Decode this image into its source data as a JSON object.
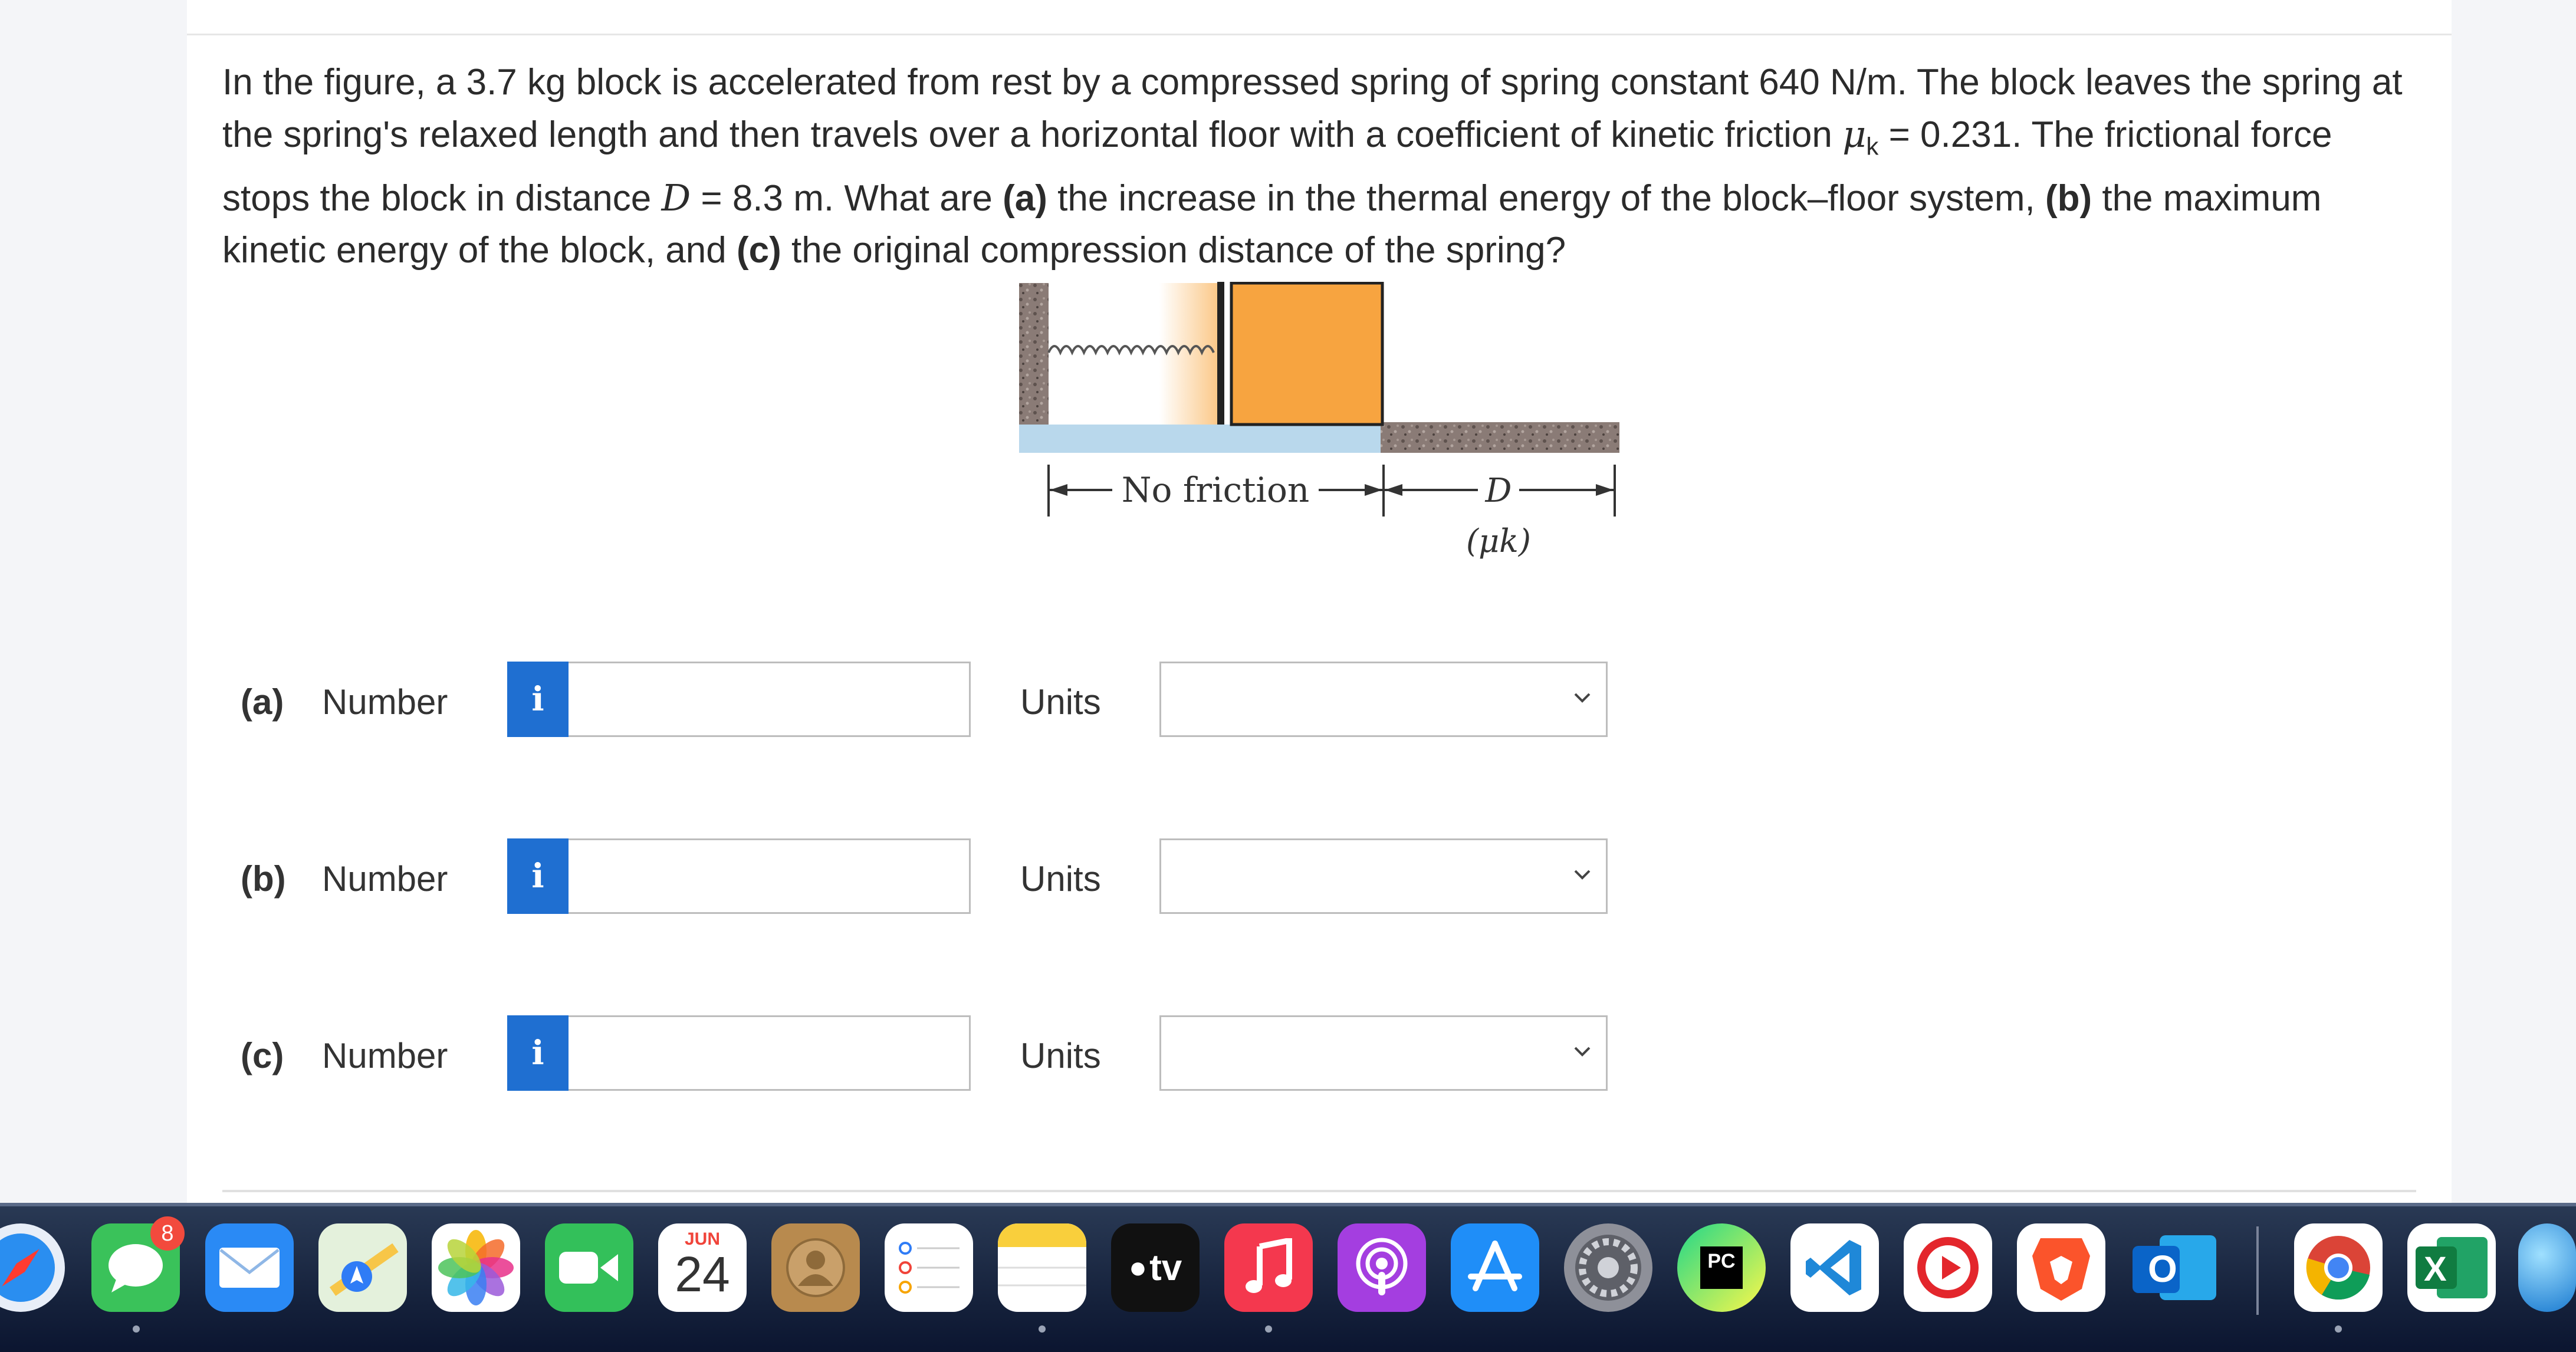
{
  "question": {
    "part1": "In the figure, a 3.7 kg block is accelerated from rest by a compressed spring of spring constant 640 N/m. The block leaves the spring at the spring's relaxed length and then travels over a horizontal floor with a coefficient of kinetic friction ",
    "mu_symbol": "μ",
    "mu_sub": "k",
    "part2": " = 0.231. The frictional force stops the block in distance ",
    "d_symbol": "D",
    "part3": " = 8.3 m. What are ",
    "a_tag": "(a)",
    "part4": " the increase in the thermal energy of the block–floor system, ",
    "b_tag": "(b)",
    "part5": " the maximum kinetic energy of the block, and ",
    "c_tag": "(c)",
    "part6": " the original compression distance of the spring?"
  },
  "figure": {
    "no_friction_label": "No friction",
    "d_label": "D",
    "mu_label": "(μk)"
  },
  "answers": [
    {
      "letter": "(a)",
      "number_label": "Number",
      "info_glyph": "i",
      "value": "",
      "units_label": "Units",
      "units_value": ""
    },
    {
      "letter": "(b)",
      "number_label": "Number",
      "info_glyph": "i",
      "value": "",
      "units_label": "Units",
      "units_value": ""
    },
    {
      "letter": "(c)",
      "number_label": "Number",
      "info_glyph": "i",
      "value": "",
      "units_label": "Units",
      "units_value": ""
    }
  ],
  "dock": {
    "badges": {
      "messages": "8"
    },
    "calendar": {
      "month": "JUN",
      "day": "24"
    },
    "appletv_label": "tv",
    "pycharm_label": "PC",
    "outlook_label": "O",
    "excel_label": "X",
    "icons": [
      "safari-icon",
      "messages-icon",
      "mail-icon",
      "maps-icon",
      "photos-icon",
      "facetime-icon",
      "calendar-icon",
      "contacts-icon",
      "reminders-icon",
      "notes-icon",
      "appletv-icon",
      "music-icon",
      "podcasts-icon",
      "appstore-icon",
      "settings-icon",
      "pycharm-icon",
      "vscode-icon",
      "recorder-icon",
      "brave-icon",
      "outlook-icon",
      "chrome-icon",
      "excel-icon",
      "globe-icon"
    ]
  },
  "colors": {
    "info_blue": "#1f6fd1",
    "block_orange": "#f7a440",
    "ice_blue": "#b9d8ec",
    "ground": "#7d6f6a"
  }
}
